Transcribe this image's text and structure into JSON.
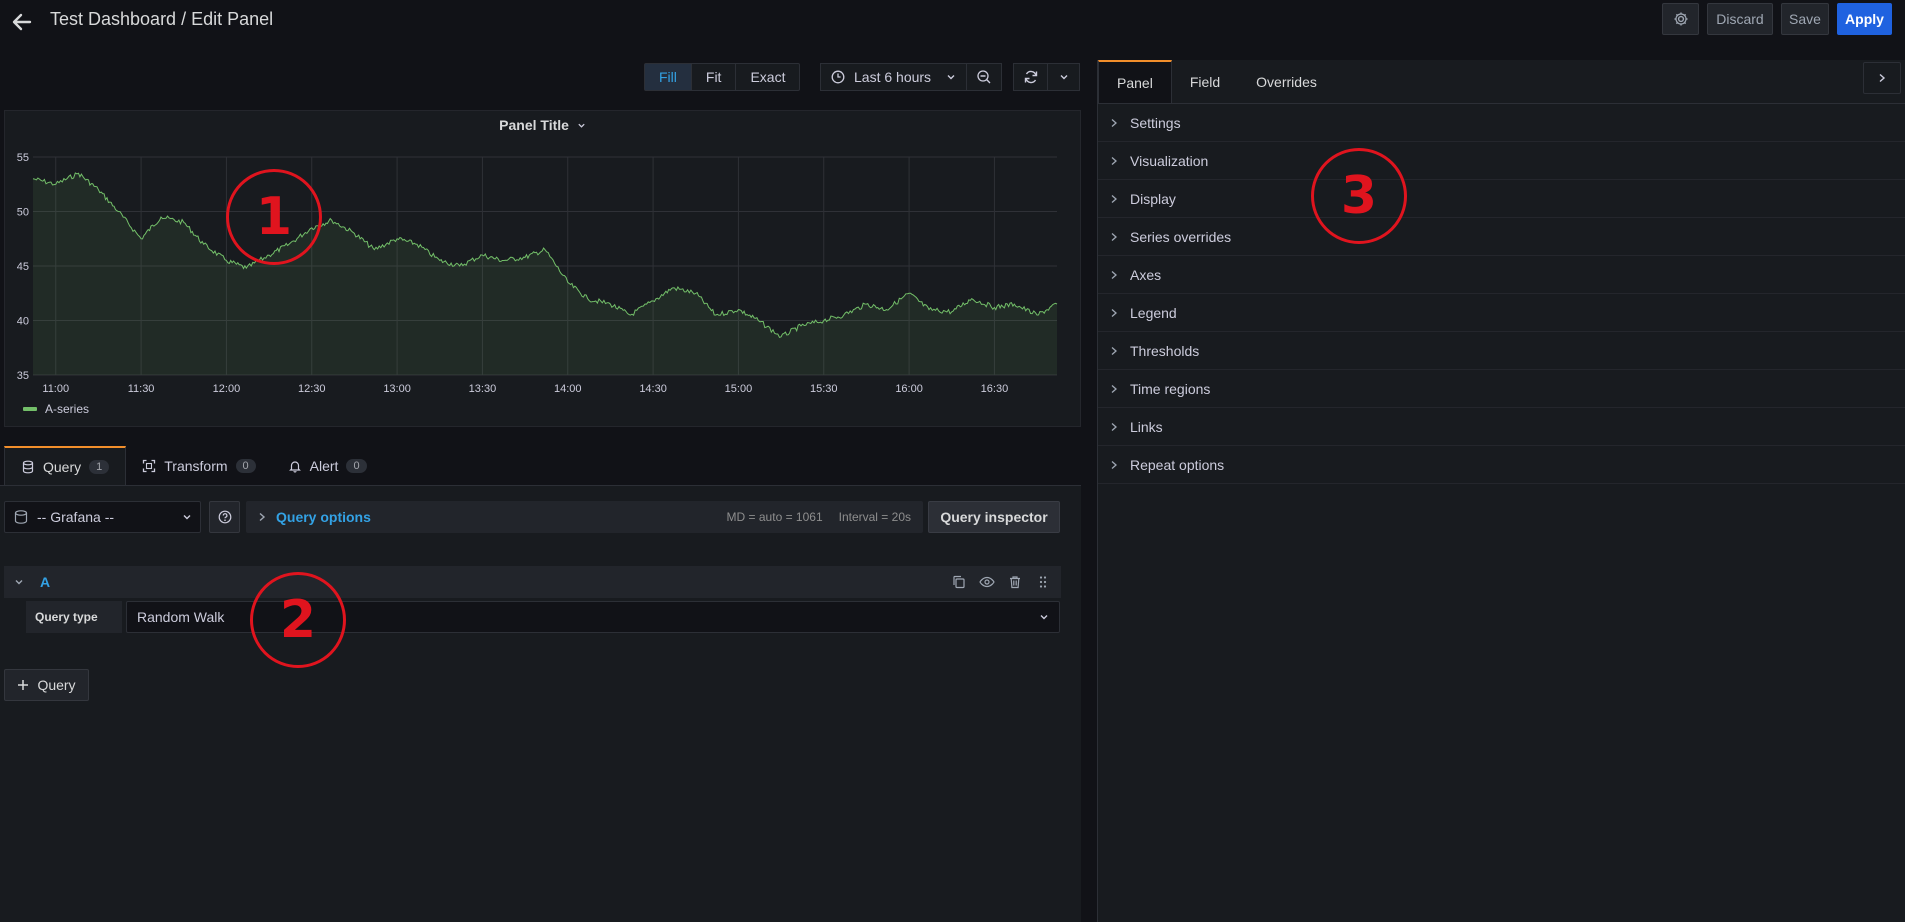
{
  "header": {
    "title": "Test Dashboard / Edit Panel",
    "discard_label": "Discard",
    "save_label": "Save",
    "apply_label": "Apply"
  },
  "toolbar": {
    "display_modes": [
      "Fill",
      "Fit",
      "Exact"
    ],
    "active_mode": "Fill",
    "time_range": "Last 6 hours"
  },
  "panel": {
    "title": "Panel Title",
    "legend": [
      "A-series"
    ]
  },
  "chart_data": {
    "type": "line",
    "series": [
      {
        "name": "A-series",
        "color": "#73bf69",
        "x": [
          "10:52",
          "11:00",
          "11:08",
          "11:15",
          "11:22",
          "11:30",
          "11:37",
          "11:45",
          "11:52",
          "12:00",
          "12:07",
          "12:15",
          "12:22",
          "12:30",
          "12:37",
          "12:45",
          "12:52",
          "13:00",
          "13:07",
          "13:15",
          "13:22",
          "13:30",
          "13:37",
          "13:45",
          "13:52",
          "14:00",
          "14:07",
          "14:15",
          "14:22",
          "14:30",
          "14:37",
          "14:45",
          "14:52",
          "15:00",
          "15:07",
          "15:15",
          "15:22",
          "15:30",
          "15:37",
          "15:45",
          "15:52",
          "16:00",
          "16:07",
          "16:15",
          "16:22",
          "16:30",
          "16:37",
          "16:45",
          "16:52"
        ],
        "values": [
          53.0,
          52.5,
          53.5,
          52.0,
          50.0,
          47.5,
          49.5,
          49.0,
          47.0,
          45.5,
          44.8,
          46.0,
          47.0,
          48.5,
          49.2,
          48.0,
          46.5,
          47.5,
          47.0,
          45.5,
          45.0,
          46.0,
          45.5,
          45.8,
          46.5,
          43.5,
          42.0,
          41.5,
          40.5,
          41.8,
          43.0,
          42.5,
          40.5,
          41.0,
          40.0,
          38.5,
          39.5,
          40.0,
          40.5,
          41.5,
          41.0,
          42.5,
          41.0,
          40.8,
          42.0,
          41.2,
          41.5,
          40.5,
          41.5
        ]
      }
    ],
    "yticks": [
      35,
      40,
      45,
      50,
      55
    ],
    "xticks": [
      "11:00",
      "11:30",
      "12:00",
      "12:30",
      "13:00",
      "13:30",
      "14:00",
      "14:30",
      "15:00",
      "15:30",
      "16:00",
      "16:30"
    ],
    "ylim": [
      35,
      55
    ],
    "grid": true,
    "legend_placement": "bottom-left"
  },
  "query_tabs": [
    {
      "label": "Query",
      "count": "1",
      "icon": "database-icon"
    },
    {
      "label": "Transform",
      "count": "0",
      "icon": "transform-icon"
    },
    {
      "label": "Alert",
      "count": "0",
      "icon": "bell-icon"
    }
  ],
  "query_editor": {
    "datasource": "-- Grafana --",
    "options_label": "Query options",
    "md_info": "MD = auto = 1061",
    "interval_info": "Interval = 20s",
    "inspector_label": "Query inspector",
    "query_name": "A",
    "query_type_label": "Query type",
    "query_type_value": "Random Walk",
    "add_query_label": "Query"
  },
  "options_pane": {
    "tabs": [
      "Panel",
      "Field",
      "Overrides"
    ],
    "active_tab": "Panel",
    "sections": [
      "Settings",
      "Visualization",
      "Display",
      "Series overrides",
      "Axes",
      "Legend",
      "Thresholds",
      "Time regions",
      "Links",
      "Repeat options"
    ]
  },
  "annotations": [
    "1",
    "2",
    "3"
  ]
}
